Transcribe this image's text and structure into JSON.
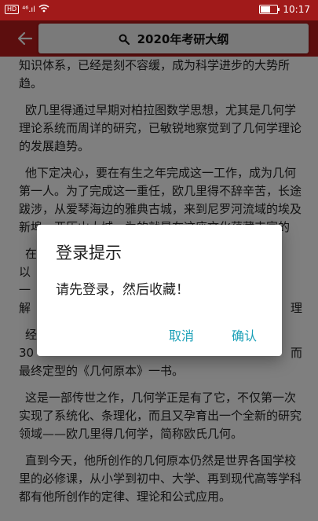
{
  "status_bar": {
    "network_badge": "HD",
    "signal": "⁴⁶.ıl",
    "wifi_icon": "wifi-icon",
    "time": "10:17"
  },
  "app_bar": {
    "back_icon": "arrow-left-icon",
    "search_icon": "search-icon",
    "title": "2020年考研大纲"
  },
  "article": {
    "paragraphs": [
      "知识体系，已经是刻不容缓，成为科学进步的大势所趋。",
      "欧几里得通过早期对柏拉图数学思想，尤其是几何学理论系统而周详的研究，已敏锐地察觉到了几何学理论的发展趋势。",
      "他下定决心，要在有生之年完成这一工作，成为几何第一人。为了完成这一重任，欧几里得不辞辛苦，长途跋涉，从爱琴海边的雅典古城，来到尼罗河流域的埃及新埠一亚历山大城，为的就是在这座文化蕴藏丰富的",
      "在",
      "以",
      "一",
      "解",
      "经",
      "30",
      "最终定型的《几何原本》一书。",
      "这是一部传世之作，几何学正是有了它，不仅第一次实现了系统化、条理化，而且又孕育出一个全新的研究领域——欧几里得几何学，简称欧氏几何。",
      "直到今天，他所创作的几何原本仍然是世界各国学校里的必修课，从小学到初中、大学、再到现代高等学科都有他所创作的定律、理论和公式应用。"
    ],
    "right_fragments": [
      "理",
      "而"
    ]
  },
  "dialog": {
    "title": "登录提示",
    "message": "请先登录，然后收藏！",
    "cancel_label": "取消",
    "confirm_label": "确认",
    "button_color": "#1aa0b7"
  },
  "colors": {
    "primary": "#b81c1c",
    "status_bar": "#a11a1a"
  }
}
